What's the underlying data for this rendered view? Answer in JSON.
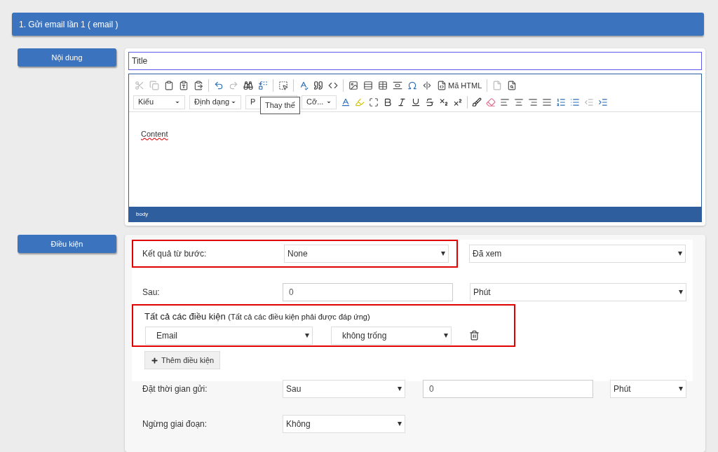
{
  "section_header": {
    "title": "1. Gửi email lần 1 ( email )"
  },
  "content_label": "Nội dung",
  "editor": {
    "title_value": "Title",
    "toolbar_source_label": "Mã HTML",
    "dropdowns": [
      "Kiểu",
      "Định dạng",
      "P",
      "Cỡ..."
    ],
    "tooltip": "Thay thế",
    "content": "Content",
    "status_path": "body"
  },
  "conditions_label": "Điều kiện",
  "result_row": {
    "label": "Kết quả từ bước:",
    "step_value": "None",
    "status_value": "Đã xem",
    "highlighted": true
  },
  "after_row": {
    "label": "Sau:",
    "amount_value": "0",
    "unit_value": "Phút"
  },
  "condition_group": {
    "title": "Tất cả các điều kiện",
    "note": "(Tất cả các điều kiện phải được đáp ứng)",
    "highlighted": true,
    "conditions": [
      {
        "field": "Email",
        "operator": "không trống"
      }
    ],
    "add_button": "Thêm điều kiện"
  },
  "send_time_row": {
    "label": "Đặt thời gian gửi:",
    "mode_value": "Sau",
    "amount_value": "0",
    "unit_value": "Phút"
  },
  "stop_row": {
    "label": "Ngừng giai đoạn:",
    "value": "Không"
  }
}
